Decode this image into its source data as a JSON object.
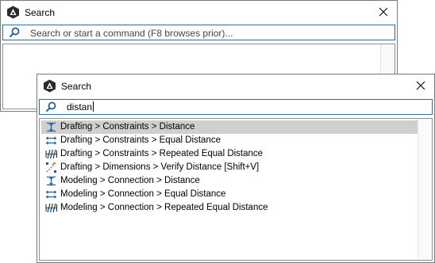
{
  "background_window": {
    "title": "Search",
    "search": {
      "placeholder": "Search or start a command (F8 browses prior)..."
    }
  },
  "foreground_window": {
    "title": "Search",
    "search": {
      "value": "distan"
    },
    "results": [
      {
        "label": "Drafting > Constraints > Distance",
        "icon": "distance-constraint-icon",
        "selected": true
      },
      {
        "label": "Drafting > Constraints > Equal Distance",
        "icon": "equal-distance-icon",
        "selected": false
      },
      {
        "label": "Drafting > Constraints > Repeated Equal Distance",
        "icon": "repeated-equal-distance-icon",
        "selected": false
      },
      {
        "label": "Drafting > Dimensions > Verify Distance [Shift+V]",
        "icon": "verify-distance-icon",
        "selected": false
      },
      {
        "label": "Modeling > Connection > Distance",
        "icon": "distance-constraint-icon",
        "selected": false
      },
      {
        "label": "Modeling > Connection > Equal Distance",
        "icon": "equal-distance-icon",
        "selected": false
      },
      {
        "label": "Modeling > Connection > Repeated Equal Distance",
        "icon": "repeated-equal-distance-icon",
        "selected": false
      }
    ]
  },
  "colors": {
    "accent": "#1a5fa8",
    "selection": "#cfcfcf",
    "border": "#7a7a7a"
  }
}
